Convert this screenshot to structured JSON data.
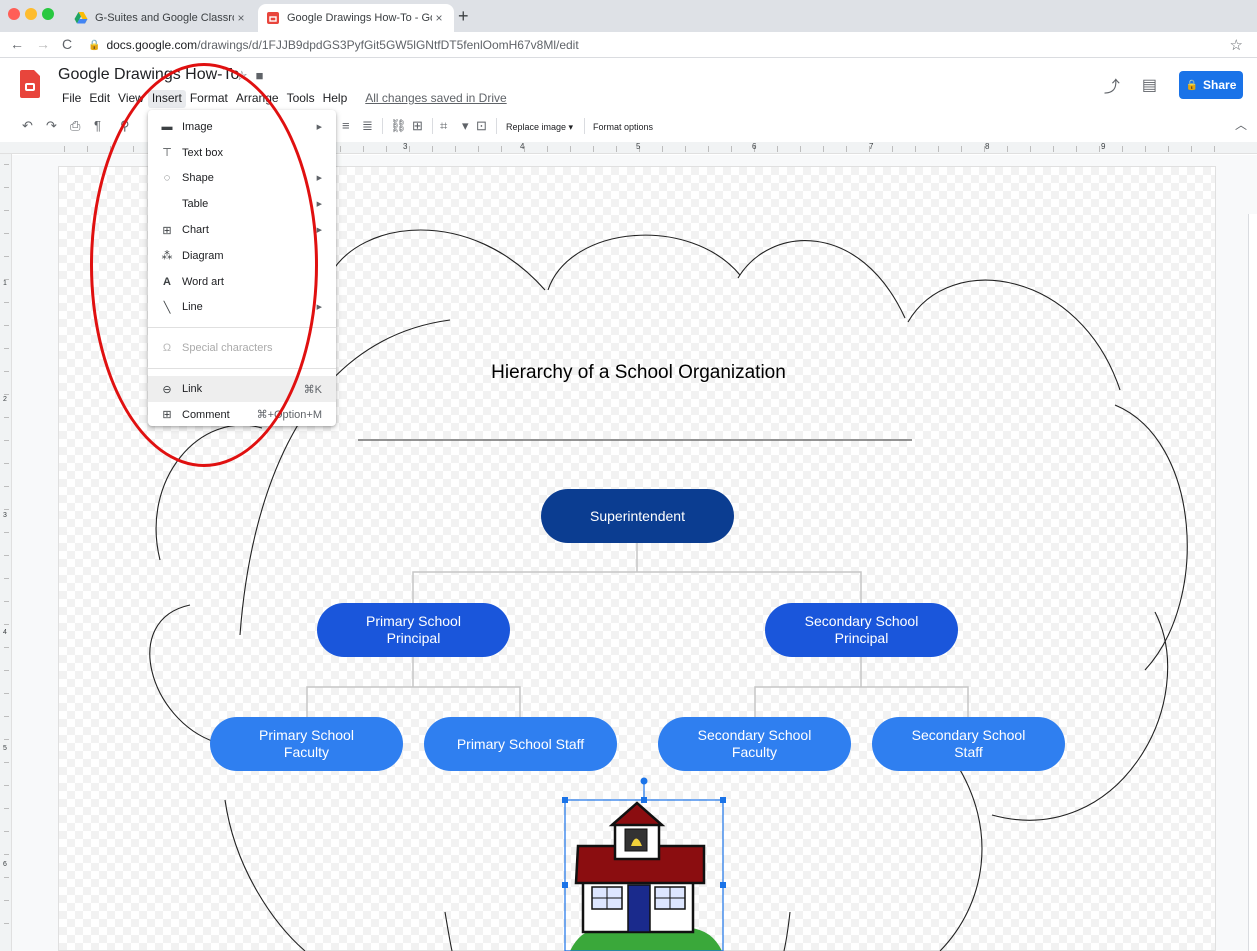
{
  "browser": {
    "tabs": [
      {
        "title": "G-Suites and Google Classroo",
        "close": "×"
      },
      {
        "title": "Google Drawings How-To - Go",
        "close": "×"
      }
    ],
    "new_tab": "+",
    "url_host": "docs.google.com",
    "url_path": "/drawings/d/1FJJB9dpdGS3PyfGit5GW5lGNtfDT5fenlOomH67v8Ml/edit"
  },
  "app": {
    "title": "Google Drawings How-To",
    "menus": [
      "File",
      "Edit",
      "View",
      "Insert",
      "Format",
      "Arrange",
      "Tools",
      "Help"
    ],
    "saved_status": "All changes saved in Drive",
    "share_label": "Share"
  },
  "toolbar": {
    "replace_image": "Replace image ▾",
    "format_options": "Format options"
  },
  "ruler": {
    "h_numbers": [
      "3",
      "4",
      "5",
      "6",
      "7",
      "8",
      "9"
    ],
    "v_numbers": [
      "1",
      "2",
      "3",
      "4",
      "5",
      "6"
    ]
  },
  "insert_menu": {
    "items": [
      {
        "label": "Image",
        "icon": "image-icon",
        "submenu": true
      },
      {
        "label": "Text box",
        "icon": "text-box-icon",
        "submenu": false
      },
      {
        "label": "Shape",
        "icon": "shape-icon",
        "submenu": true
      },
      {
        "label": "Table",
        "icon": "",
        "submenu": true
      },
      {
        "label": "Chart",
        "icon": "chart-icon",
        "submenu": true
      },
      {
        "label": "Diagram",
        "icon": "diagram-icon",
        "submenu": false
      },
      {
        "label": "Word art",
        "icon": "word-art-icon",
        "submenu": false
      },
      {
        "label": "Line",
        "icon": "line-icon",
        "submenu": true
      },
      {
        "label": "Special characters",
        "icon": "omega-icon",
        "disabled": true
      },
      {
        "label": "Link",
        "icon": "link-icon",
        "shortcut": "⌘K"
      },
      {
        "label": "Comment",
        "icon": "comment-icon",
        "shortcut": "⌘+Option+M"
      }
    ]
  },
  "diagram": {
    "title": "Hierarchy of a School Organization",
    "root": "Superintendent",
    "level2": [
      "Primary School\nPrincipal",
      "Secondary School\nPrincipal"
    ],
    "level3": [
      "Primary School\nFaculty",
      "Primary School Staff",
      "Secondary School\nFaculty",
      "Secondary School\nStaff"
    ]
  },
  "colors": {
    "accent": "#1a73e8",
    "node_dark": "#0b3d91",
    "node_mid": "#1a56db",
    "node_light": "#2f7ff0",
    "annotation": "#e01010"
  }
}
